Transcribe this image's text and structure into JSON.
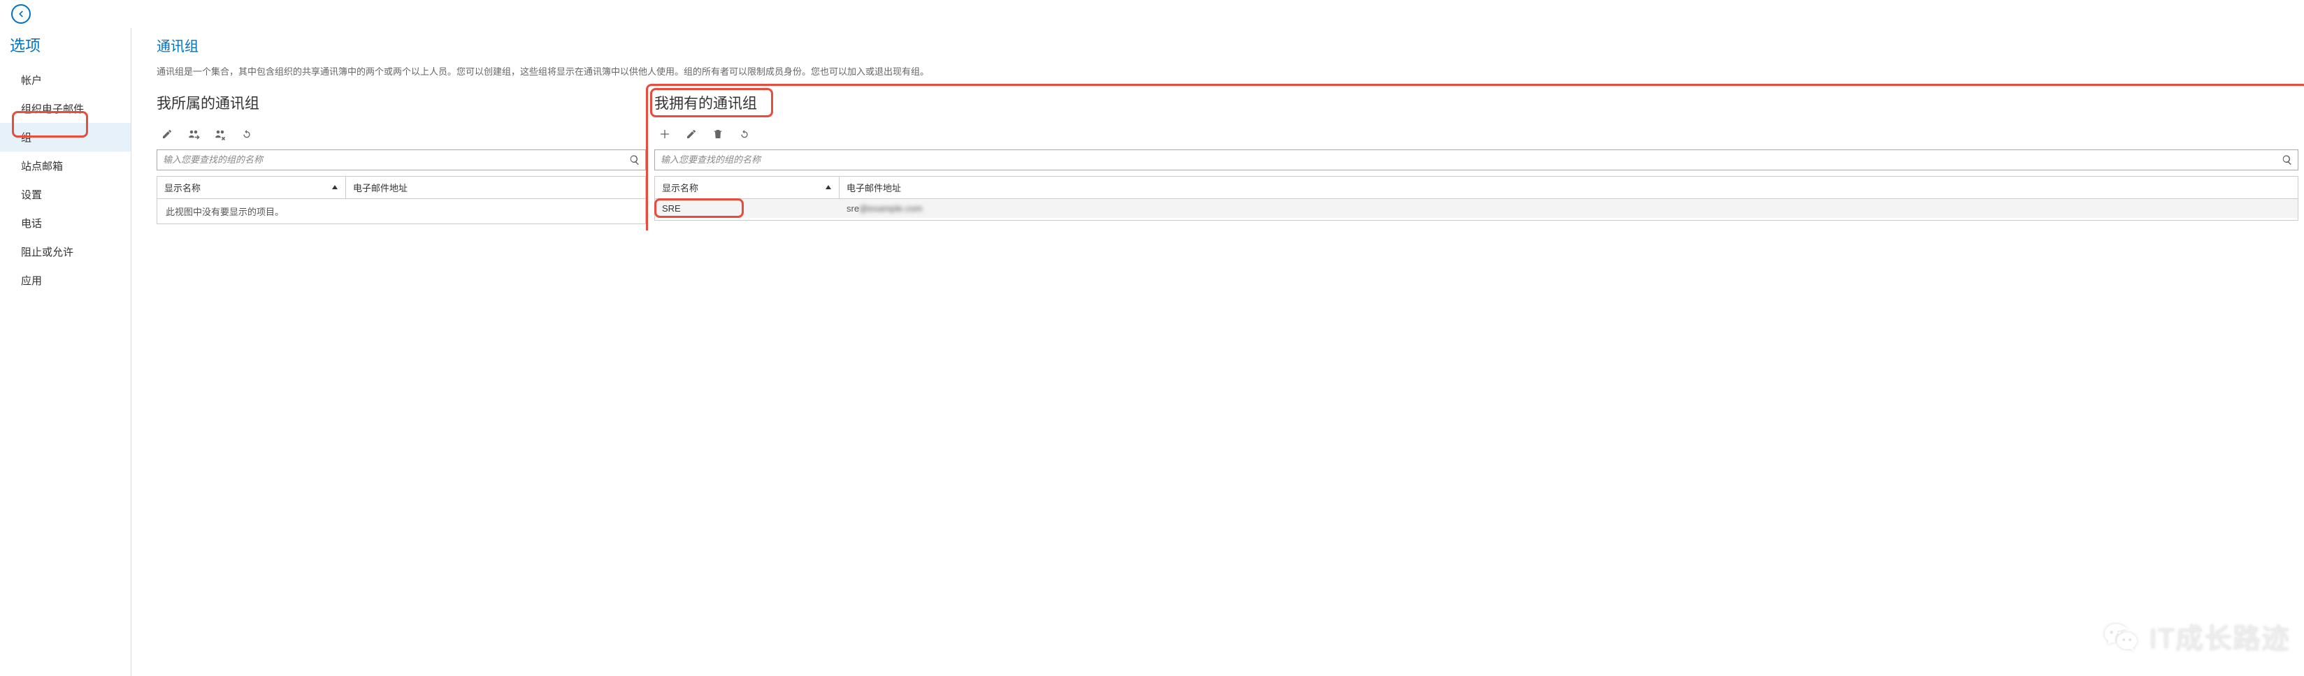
{
  "sidebar": {
    "title": "选项",
    "items": [
      {
        "label": "帐户"
      },
      {
        "label": "组织电子邮件"
      },
      {
        "label": "组",
        "selected": true
      },
      {
        "label": "站点邮箱"
      },
      {
        "label": "设置"
      },
      {
        "label": "电话"
      },
      {
        "label": "阻止或允许"
      },
      {
        "label": "应用"
      }
    ]
  },
  "page": {
    "title": "通讯组",
    "description": "通讯组是一个集合，其中包含组织的共享通讯簿中的两个或两个以上人员。您可以创建组，这些组将显示在通讯簿中以供他人使用。组的所有者可以限制成员身份。您也可以加入或退出现有组。"
  },
  "panels": {
    "left": {
      "title": "我所属的通讯组",
      "search_placeholder": "输入您要查找的组的名称",
      "columns": {
        "name": "显示名称",
        "email": "电子邮件地址"
      },
      "empty": "此视图中没有要显示的项目。"
    },
    "right": {
      "title": "我拥有的通讯组",
      "search_placeholder": "输入您要查找的组的名称",
      "columns": {
        "name": "显示名称",
        "email": "电子邮件地址"
      },
      "rows": [
        {
          "name": "SRE",
          "email": "sre"
        }
      ]
    }
  },
  "watermark": "IT成长路迹"
}
